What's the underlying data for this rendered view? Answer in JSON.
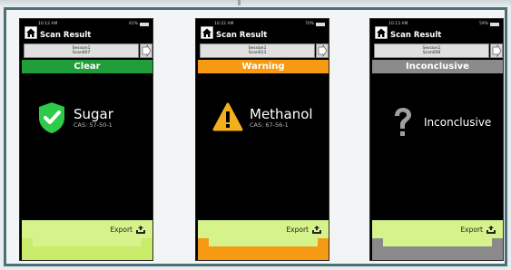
{
  "screens": [
    {
      "status_time": "10:12 AM",
      "status_battery": "61%",
      "title": "Scan Result",
      "session_line1": "Session1",
      "session_line2": "Scan007",
      "banner": "Clear",
      "substance": "Sugar",
      "cas": "CAS: 57-50-1",
      "export_label": "Export",
      "icon": "shield-check-icon",
      "colors": {
        "banner": "#1f9e3a",
        "export": "#d6f28a",
        "band": "#c8ec6a",
        "notch": "#d6f28a",
        "icon": "#2ecb4a"
      }
    },
    {
      "status_time": "10:22 AM",
      "status_battery": "70%",
      "title": "Scan Result",
      "session_line1": "Session1",
      "session_line2": "Scan013",
      "banner": "Warning",
      "substance": "Methanol",
      "cas": "CAS: 67-56-1",
      "export_label": "Export",
      "icon": "warning-triangle-icon",
      "colors": {
        "banner": "#f59a12",
        "export": "#d6f28a",
        "band": "#f59a12",
        "notch": "#d6f28a",
        "icon": "#f2b01e"
      }
    },
    {
      "status_time": "10:13 AM",
      "status_battery": "59%",
      "title": "Scan Result",
      "session_line1": "Session1",
      "session_line2": "Scan008",
      "banner": "Inconclusive",
      "substance": "Inconclusive",
      "cas": "",
      "export_label": "Export",
      "icon": "question-mark-icon",
      "colors": {
        "banner": "#8a8a8a",
        "export": "#d6f28a",
        "band": "#8a8a8a",
        "notch": "#d6f28a",
        "icon": "#a0a0a0"
      }
    }
  ]
}
